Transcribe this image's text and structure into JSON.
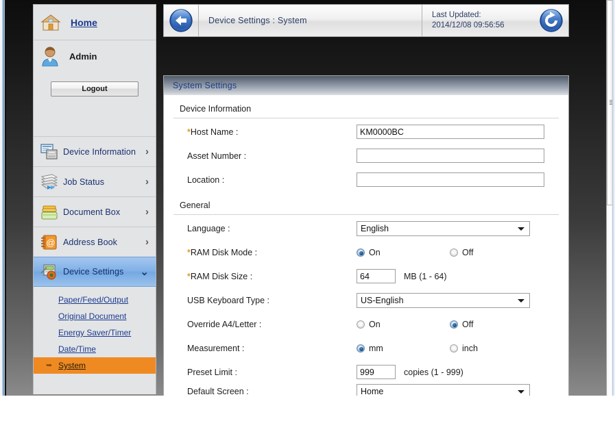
{
  "sidebar": {
    "home_label": "Home",
    "user_label": "Admin",
    "logout_label": "Logout",
    "nav": [
      {
        "label": "Device Information",
        "icon": "device-information-icon",
        "chevron": "›",
        "active": false
      },
      {
        "label": "Job Status",
        "icon": "job-status-icon",
        "chevron": "›",
        "active": false
      },
      {
        "label": "Document Box",
        "icon": "document-box-icon",
        "chevron": "›",
        "active": false
      },
      {
        "label": "Address Book",
        "icon": "address-book-icon",
        "chevron": "›",
        "active": false
      },
      {
        "label": "Device Settings",
        "icon": "device-settings-icon",
        "chevron": "⌄",
        "active": true
      }
    ],
    "sub_items": [
      {
        "label": "Paper/Feed/Output",
        "selected": false
      },
      {
        "label": "Original Document",
        "selected": false
      },
      {
        "label": "Energy Saver/Timer",
        "selected": false
      },
      {
        "label": "Date/Time",
        "selected": false
      },
      {
        "label": "System",
        "selected": true
      }
    ]
  },
  "topbar": {
    "back_icon": "back-arrow-icon",
    "breadcrumb": "Device Settings : System",
    "last_updated_label": "Last Updated:",
    "last_updated_value": "2014/12/08 09:56:56",
    "refresh_icon": "refresh-icon"
  },
  "panel": {
    "title": "System Settings",
    "sections": [
      {
        "title": "Device Information",
        "rows": [
          {
            "label": "Host Name :",
            "required": true,
            "type": "text",
            "value": "KM0000BC",
            "width": "wide"
          },
          {
            "label": "Asset Number :",
            "required": false,
            "type": "text",
            "value": "",
            "width": "wide"
          },
          {
            "label": "Location :",
            "required": false,
            "type": "text",
            "value": "",
            "width": "wide"
          }
        ]
      },
      {
        "title": "General",
        "rows": [
          {
            "label": "Language :",
            "required": false,
            "type": "select",
            "value": "English"
          },
          {
            "label": "RAM Disk Mode :",
            "required": true,
            "type": "radio",
            "options": [
              {
                "label": "On",
                "selected": true
              },
              {
                "label": "Off",
                "selected": false
              }
            ]
          },
          {
            "label": "RAM Disk Size :",
            "required": true,
            "type": "text",
            "value": "64",
            "width": "small",
            "unit": "MB (1 - 64)"
          },
          {
            "label": "USB Keyboard Type :",
            "required": false,
            "type": "select",
            "value": "US-English"
          },
          {
            "label": "Override A4/Letter :",
            "required": false,
            "type": "radio",
            "options": [
              {
                "label": "On",
                "selected": false
              },
              {
                "label": "Off",
                "selected": true
              }
            ]
          },
          {
            "label": "Measurement :",
            "required": false,
            "type": "radio",
            "options": [
              {
                "label": "mm",
                "selected": true
              },
              {
                "label": "inch",
                "selected": false
              }
            ]
          },
          {
            "label": "Preset Limit :",
            "required": false,
            "type": "text",
            "value": "999",
            "width": "small",
            "unit": "copies (1 - 999)"
          },
          {
            "label": "Default Screen :",
            "required": false,
            "type": "select",
            "value": "Home",
            "partial": true
          }
        ]
      }
    ]
  },
  "colors": {
    "link": "#1a3b8f",
    "accent_selected": "#ef8a22",
    "nav_active": "#7fb0e6",
    "required_marker": "#d9a22a",
    "panel_title": "#1f3f86"
  }
}
